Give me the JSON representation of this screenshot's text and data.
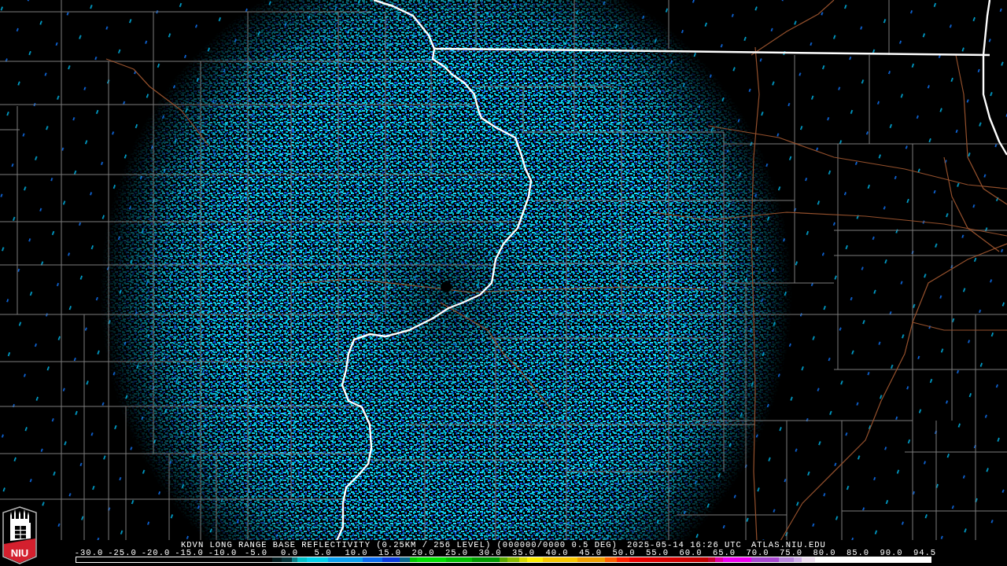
{
  "product": {
    "title": "KDVN LONG RANGE BASE REFLECTIVITY (0.25KM / 256 LEVEL) (000000/0000 0.5 DEG)",
    "valid_time": "2025-05-14 16:26 UTC",
    "website": "ATLAS.NIU.EDU"
  },
  "color_scale": {
    "labels": [
      "-30.0",
      "-25.0",
      "-20.0",
      "-15.0",
      "-10.0",
      "-5.0",
      "0.0",
      "5.0",
      "10.0",
      "15.0",
      "20.0",
      "25.0",
      "30.0",
      "35.0",
      "40.0",
      "45.0",
      "50.0",
      "55.0",
      "60.0",
      "65.0",
      "70.0",
      "75.0",
      "80.0",
      "85.0",
      "90.0",
      "94.5"
    ]
  },
  "logo": {
    "text": "NIU"
  }
}
